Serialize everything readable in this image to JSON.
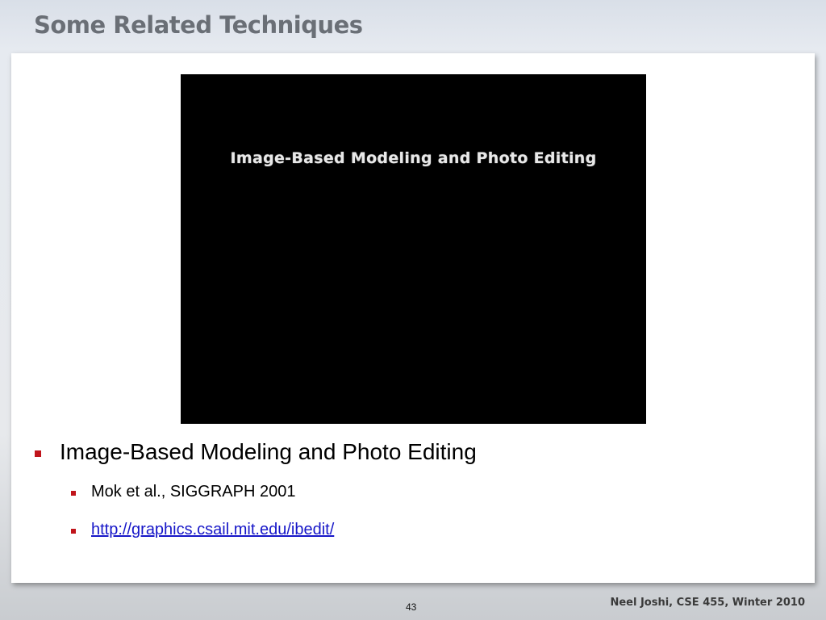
{
  "slide": {
    "title": "Some Related Techniques",
    "video": {
      "caption": "Image-Based Modeling and Photo Editing"
    },
    "bullets": {
      "main": "Image-Based Modeling and Photo Editing",
      "citation": "Mok et al., SIGGRAPH 2001",
      "link": "http://graphics.csail.mit.edu/ibedit/"
    },
    "footer": {
      "page_number": "43",
      "credit": "Neel Joshi, CSE 455, Winter 2010"
    }
  },
  "colors": {
    "title": "#6a6f76",
    "bullet_marker": "#c0141b",
    "link": "#1616c8",
    "video_background": "#000000"
  }
}
